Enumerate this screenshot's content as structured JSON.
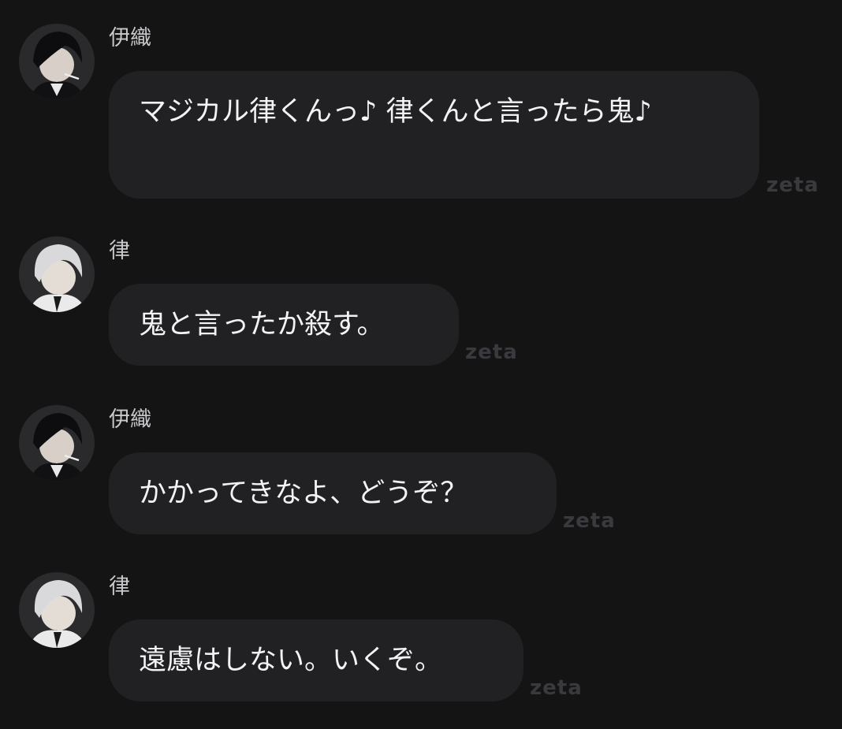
{
  "messages": [
    {
      "speaker": "伊織",
      "avatar": "dark-haired-avatar",
      "text": "マジカル律くんっ♪ 律くんと言ったら鬼♪",
      "tag": "zeta"
    },
    {
      "speaker": "律",
      "avatar": "white-haired-avatar",
      "text": "鬼と言ったか殺す。",
      "tag": "zeta"
    },
    {
      "speaker": "伊織",
      "avatar": "dark-haired-avatar",
      "text": "かかってきなよ、どうぞ？",
      "tag": "zeta"
    },
    {
      "speaker": "律",
      "avatar": "white-haired-avatar",
      "text": "遠慮はしない。いくぞ。",
      "tag": "zeta"
    }
  ],
  "colors": {
    "background": "#141415",
    "bubble": "#212124",
    "text": "#f3f3f5",
    "name": "#c9c9cc",
    "tag": "#3a3a3e"
  }
}
